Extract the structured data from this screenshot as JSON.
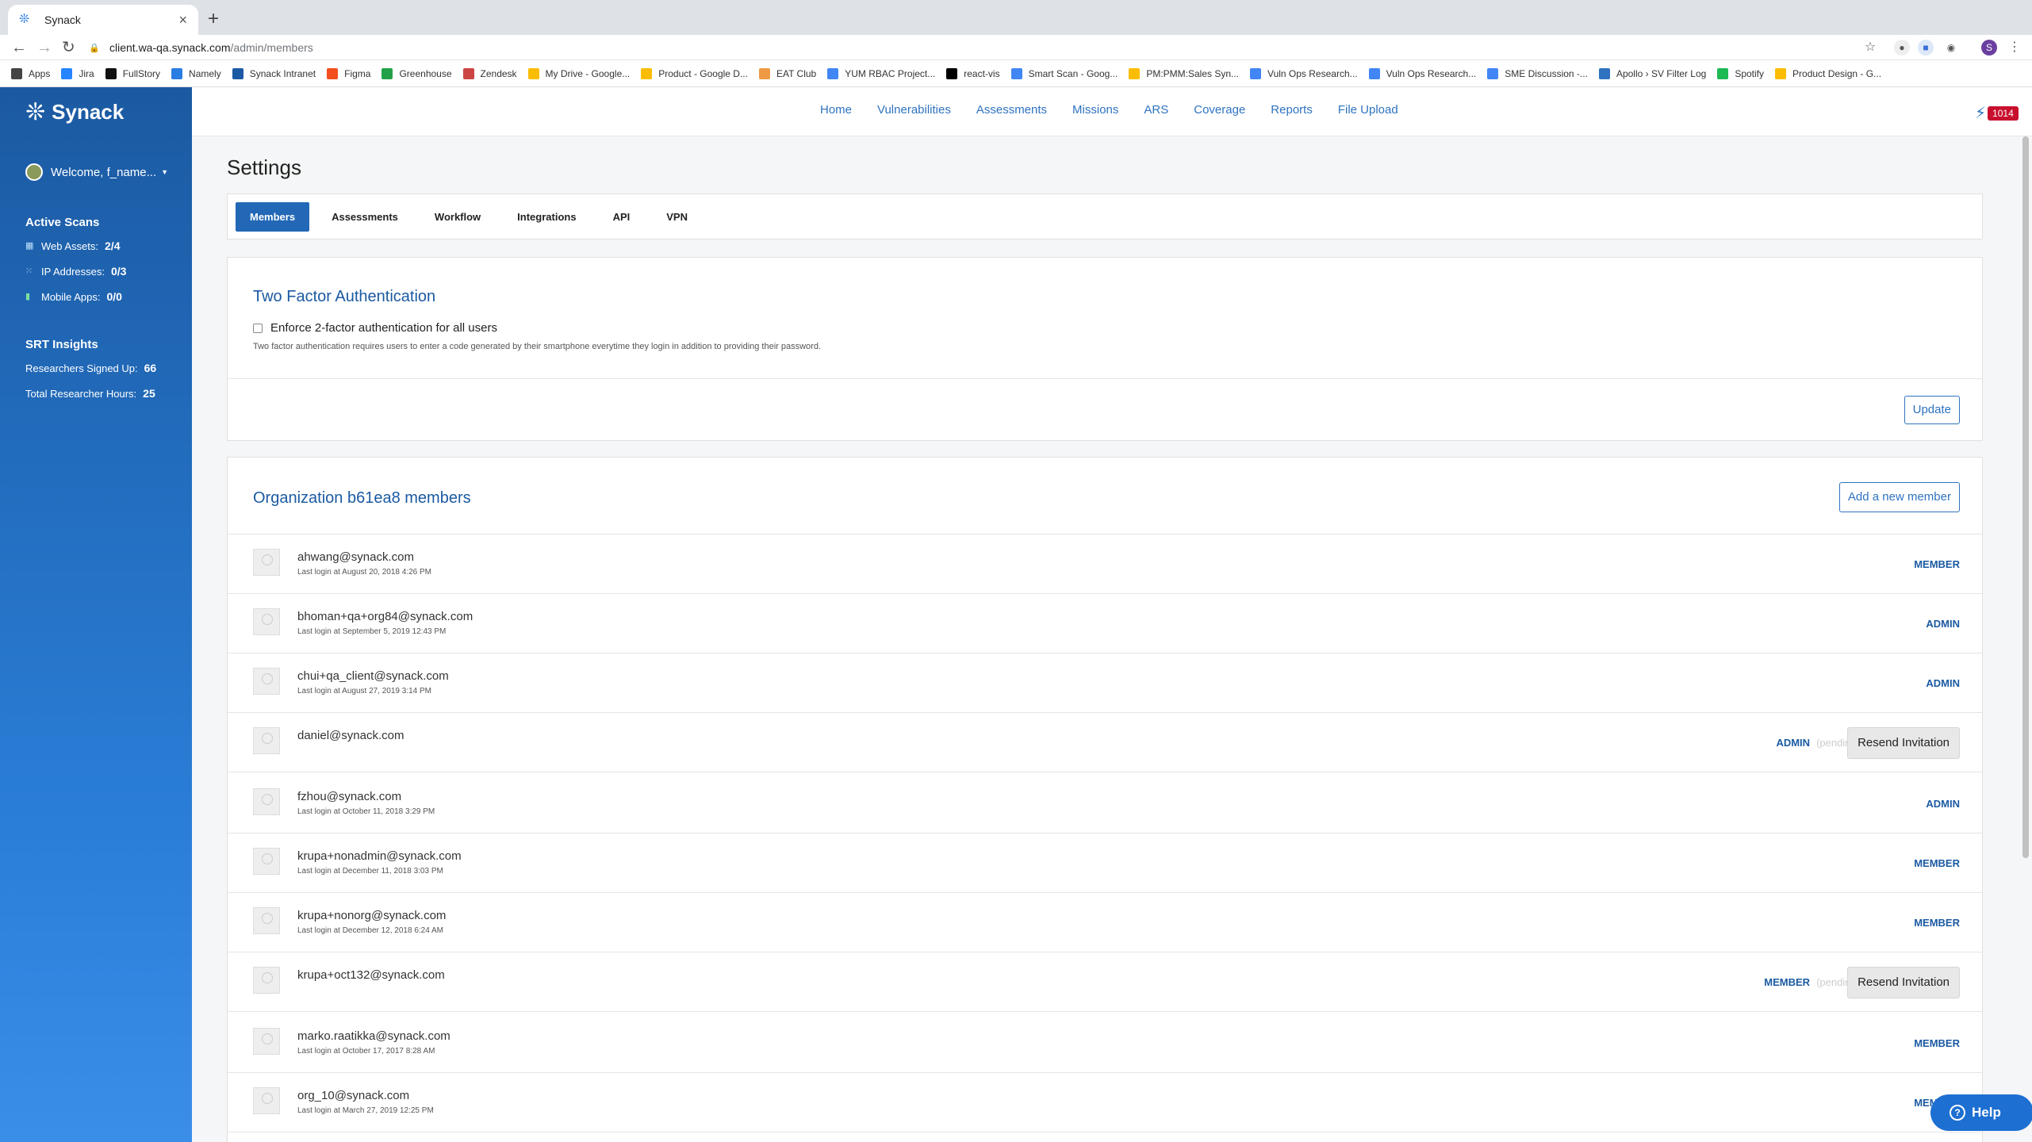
{
  "browser": {
    "tab_title": "Synack",
    "url_host": "client.wa-qa.synack.com",
    "url_path": "/admin/members",
    "profile_initial": "S",
    "bookmarks": [
      "Apps",
      "Jira",
      "FullStory",
      "Namely",
      "Synack Intranet",
      "Figma",
      "Greenhouse",
      "Zendesk",
      "My Drive - Google...",
      "Product - Google D...",
      "EAT Club",
      "YUM RBAC Project...",
      "react-vis",
      "Smart Scan - Goog...",
      "PM:PMM:Sales Syn...",
      "Vuln Ops Research...",
      "Vuln Ops Research...",
      "SME Discussion -...",
      "Apollo › SV Filter Log",
      "Spotify",
      "Product Design - G..."
    ]
  },
  "sidebar": {
    "logo": "Synack",
    "welcome": "Welcome, f_name...",
    "active_scans": {
      "heading": "Active Scans",
      "items": [
        {
          "label": "Web Assets:",
          "value": "2/4"
        },
        {
          "label": "IP Addresses:",
          "value": "0/3"
        },
        {
          "label": "Mobile Apps:",
          "value": "0/0"
        }
      ]
    },
    "srt": {
      "heading": "SRT Insights",
      "items": [
        {
          "label": "Researchers Signed Up:",
          "value": "66"
        },
        {
          "label": "Total Researcher Hours:",
          "value": "25"
        }
      ]
    }
  },
  "nav": {
    "links": [
      "Home",
      "Vulnerabilities",
      "Assessments",
      "Missions",
      "ARS",
      "Coverage",
      "Reports",
      "File Upload"
    ],
    "badge": "1014"
  },
  "page": {
    "title": "Settings",
    "tabs": [
      "Members",
      "Assessments",
      "Workflow",
      "Integrations",
      "API",
      "VPN"
    ],
    "tfa": {
      "heading": "Two Factor Authentication",
      "checkbox_label": "Enforce 2-factor authentication for all users",
      "note": "Two factor authentication requires users to enter a code generated by their smartphone everytime they login in addition to providing their password.",
      "update": "Update"
    },
    "members": {
      "heading": "Organization b61ea8 members",
      "add": "Add a new member",
      "pending_label": "(pending)",
      "resend_label": "Resend Invitation",
      "rows": [
        {
          "email": "ahwang@synack.com",
          "login": "Last login at August 20, 2018 4:26 PM",
          "role": "MEMBER"
        },
        {
          "email": "bhoman+qa+org84@synack.com",
          "login": "Last login at September 5, 2019 12:43 PM",
          "role": "ADMIN"
        },
        {
          "email": "chui+qa_client@synack.com",
          "login": "Last login at August 27, 2019 3:14 PM",
          "role": "ADMIN"
        },
        {
          "email": "daniel@synack.com",
          "login": "",
          "role": "ADMIN",
          "pending": true
        },
        {
          "email": "fzhou@synack.com",
          "login": "Last login at October 11, 2018 3:29 PM",
          "role": "ADMIN"
        },
        {
          "email": "krupa+nonadmin@synack.com",
          "login": "Last login at December 11, 2018 3:03 PM",
          "role": "MEMBER"
        },
        {
          "email": "krupa+nonorg@synack.com",
          "login": "Last login at December 12, 2018 6:24 AM",
          "role": "MEMBER"
        },
        {
          "email": "krupa+oct132@synack.com",
          "login": "",
          "role": "MEMBER",
          "pending": true
        },
        {
          "email": "marko.raatikka@synack.com",
          "login": "Last login at October 17, 2017 8:28 AM",
          "role": "MEMBER"
        },
        {
          "email": "org_10@synack.com",
          "login": "Last login at March 27, 2019 12:25 PM",
          "role": "MEMBER"
        }
      ]
    },
    "help": "Help"
  }
}
